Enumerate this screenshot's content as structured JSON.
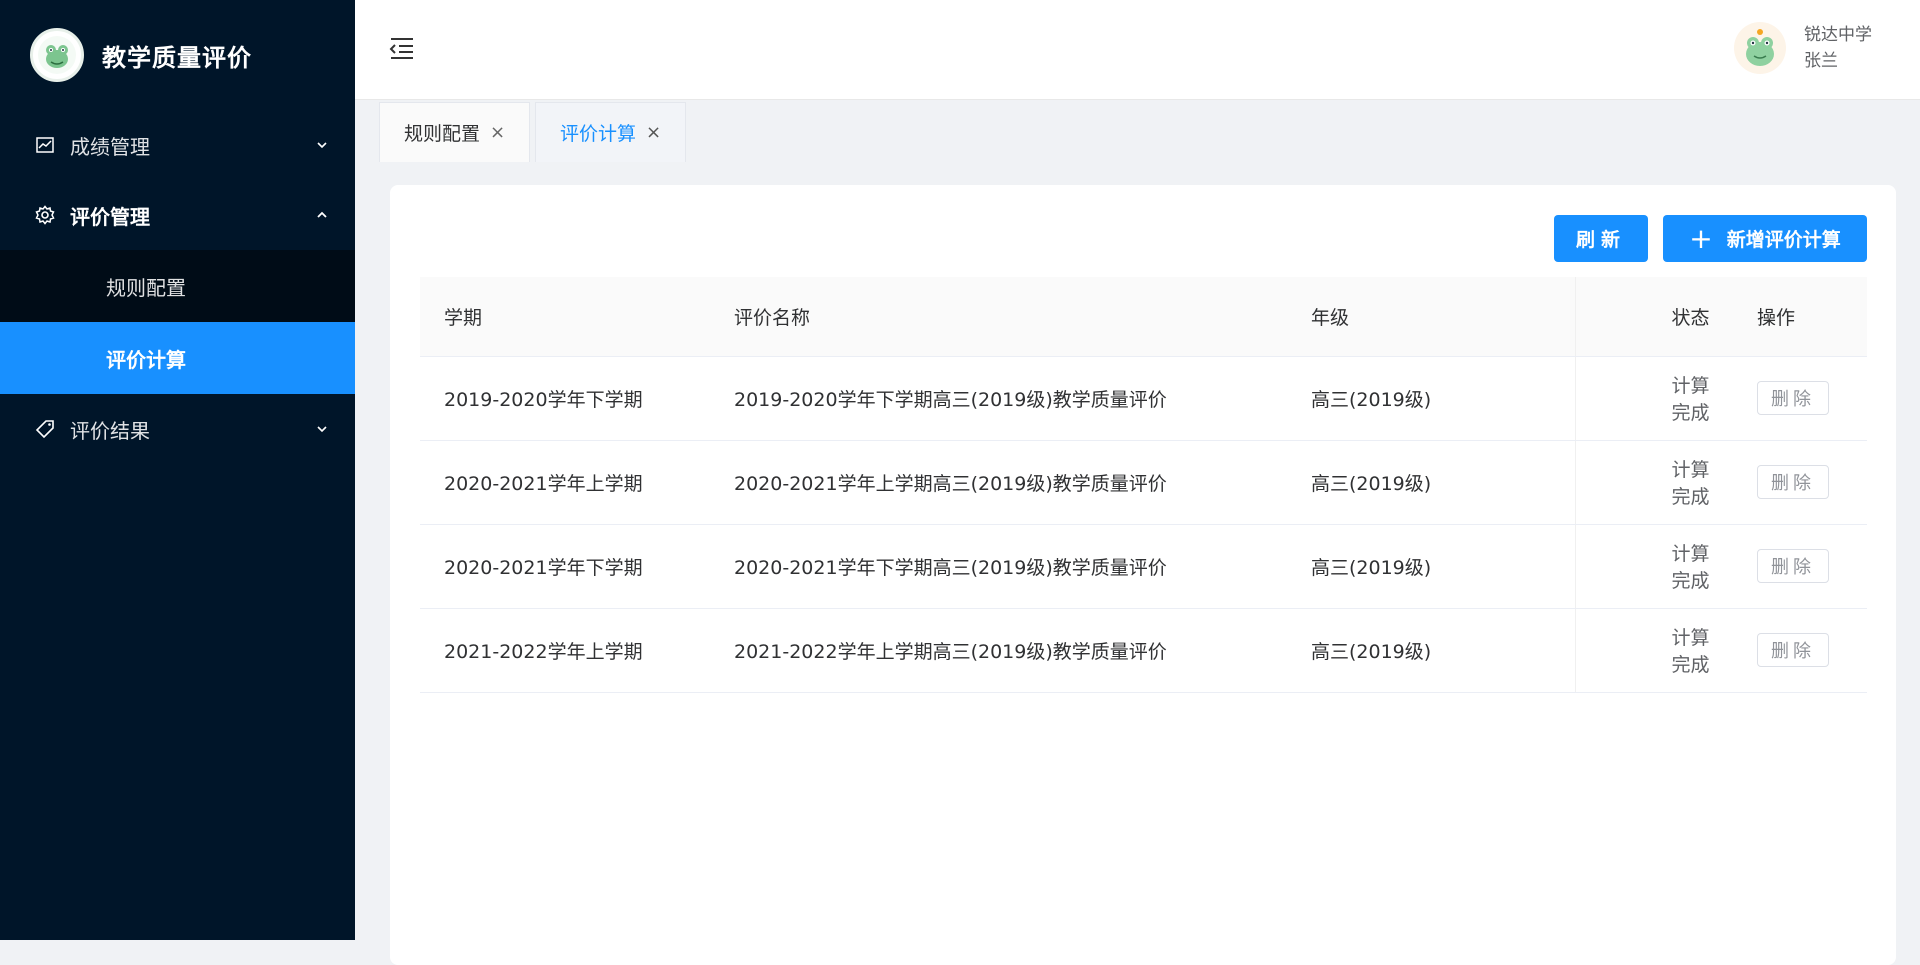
{
  "app": {
    "title": "教学质量评价",
    "logo_icon": "school-logo-icon"
  },
  "sidebar": {
    "items": [
      {
        "label": "成绩管理",
        "icon": "line-chart-icon",
        "expanded": false
      },
      {
        "label": "评价管理",
        "icon": "gear-icon",
        "expanded": true,
        "children": [
          {
            "label": "规则配置",
            "active": false
          },
          {
            "label": "评价计算",
            "active": true
          }
        ]
      },
      {
        "label": "评价结果",
        "icon": "tag-icon",
        "expanded": false
      }
    ]
  },
  "header": {
    "fold_icon": "menu-fold-icon",
    "user": {
      "school": "锐达中学",
      "name": "张兰",
      "avatar_icon": "frog-avatar-icon"
    }
  },
  "tabs": [
    {
      "label": "规则配置",
      "active": false
    },
    {
      "label": "评价计算",
      "active": true
    }
  ],
  "toolbar": {
    "refresh_label": "刷新",
    "add_label": "新增评价计算"
  },
  "table": {
    "columns": [
      "学期",
      "评价名称",
      "年级",
      "状态",
      "操作"
    ],
    "rows": [
      {
        "term": "2019-2020学年下学期",
        "name": "2019-2020学年下学期高三(2019级)教学质量评价",
        "grade": "高三(2019级)",
        "status": "计算完成",
        "action": "删除"
      },
      {
        "term": "2020-2021学年上学期",
        "name": "2020-2021学年上学期高三(2019级)教学质量评价",
        "grade": "高三(2019级)",
        "status": "计算完成",
        "action": "删除"
      },
      {
        "term": "2020-2021学年下学期",
        "name": "2020-2021学年下学期高三(2019级)教学质量评价",
        "grade": "高三(2019级)",
        "status": "计算完成",
        "action": "删除"
      },
      {
        "term": "2021-2022学年上学期",
        "name": "2021-2022学年上学期高三(2019级)教学质量评价",
        "grade": "高三(2019级)",
        "status": "计算完成",
        "action": "删除"
      }
    ]
  },
  "colors": {
    "sidebar_bg": "#001529",
    "submenu_bg": "#000c17",
    "accent": "#1890ff"
  }
}
